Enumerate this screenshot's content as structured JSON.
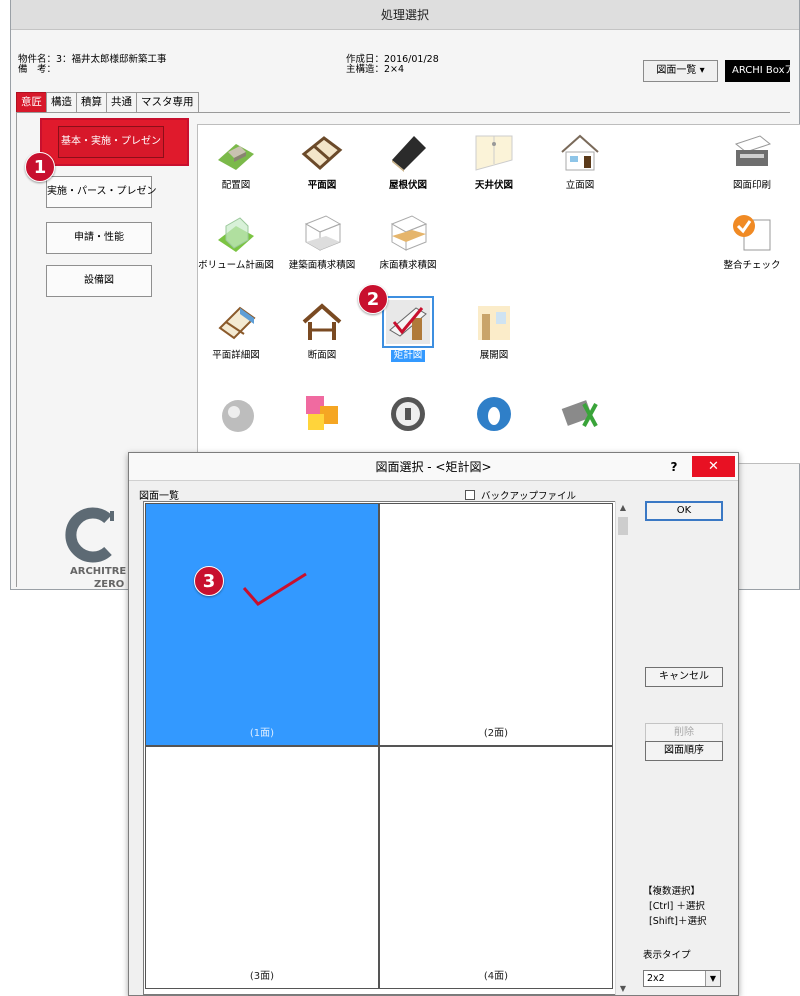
{
  "main_window": {
    "title": "処理選択",
    "project_name": "物件名：3：福井太郎様邸新築工事",
    "remarks": "備　考：",
    "created_date": "作成日：2016/01/28",
    "main_structure": "主構造：2×4",
    "drawing_list_button": "図面一覧 ▾",
    "archi_box_button": "ARCHI Boxアップ",
    "tabs": [
      "意匠",
      "構造",
      "積算",
      "共通",
      "マスタ専用"
    ],
    "categories": [
      "基本・実施・プレゼン",
      "実施・パース・プレゼン",
      "申請・性能",
      "設備図"
    ],
    "icons": [
      {
        "label": "配置図"
      },
      {
        "label": "平面図"
      },
      {
        "label": "屋根伏図"
      },
      {
        "label": "天井伏図"
      },
      {
        "label": "立面図"
      },
      {
        "label": "図面印刷"
      },
      {
        "label": "ボリューム計画図"
      },
      {
        "label": "建築面積求積図"
      },
      {
        "label": "床面積求積図"
      },
      {
        "label": "整合チェック"
      },
      {
        "label": "平面詳細図"
      },
      {
        "label": "断面図"
      },
      {
        "label": "矩計図"
      },
      {
        "label": "展開図"
      }
    ],
    "logo_text_line1": "ARCHITRE",
    "logo_text_line2": "ZERO"
  },
  "badges": [
    "1",
    "2",
    "3"
  ],
  "dialog": {
    "title": "図面選択 - <矩計図>",
    "help_label": "?",
    "close_label": "✕",
    "list_label": "図面一覧",
    "backup_label": "バックアップファイル",
    "cells": [
      "(1面)",
      "(2面)",
      "(3面)",
      "(4面)"
    ],
    "ok_label": "OK",
    "cancel_label": "キャンセル",
    "delete_label": "削除",
    "order_label": "図面順序",
    "multi_select_title": "【複数選択】",
    "multi_select_ctrl": "[Ctrl] ＋選択",
    "multi_select_shift": "[Shift]＋選択",
    "display_type_label": "表示タイプ",
    "display_type_value": "2x2"
  },
  "colors": {
    "accent_red": "#c8102e",
    "selection_blue": "#3399ff"
  }
}
